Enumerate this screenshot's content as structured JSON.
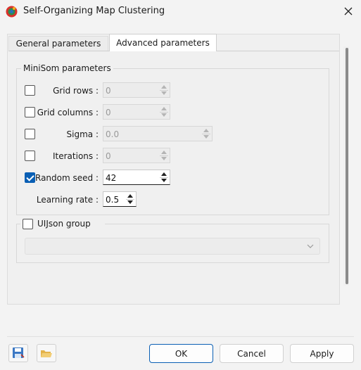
{
  "window": {
    "title": "Self-Organizing Map Clustering",
    "icons": {
      "app": "som-app-icon",
      "close": "close-icon"
    }
  },
  "tabs": [
    {
      "label": "General parameters",
      "active": false
    },
    {
      "label": "Advanced parameters",
      "active": true
    }
  ],
  "minisom": {
    "title": "MiniSom parameters",
    "fields": [
      {
        "label": "Grid rows :",
        "value": "0",
        "checked": false,
        "enabled": false
      },
      {
        "label": "Grid columns :",
        "value": "0",
        "checked": false,
        "enabled": false
      },
      {
        "label": "Sigma :",
        "value": "0.0",
        "checked": false,
        "enabled": false
      },
      {
        "label": "Iterations :",
        "value": "0",
        "checked": false,
        "enabled": false
      },
      {
        "label": "Random seed :",
        "value": "42",
        "checked": true,
        "enabled": true
      },
      {
        "label": "Learning rate :",
        "value": "0.5",
        "enabled": true
      }
    ]
  },
  "uijson": {
    "title": "UIJson group",
    "checked": false,
    "selected": ""
  },
  "footer": {
    "save_icon": "save-icon",
    "open_icon": "folder-open-icon",
    "ok_label": "OK",
    "cancel_label": "Cancel",
    "apply_label": "Apply"
  },
  "colors": {
    "accent": "#0a5fb4",
    "disabled_field": "#ececec"
  }
}
